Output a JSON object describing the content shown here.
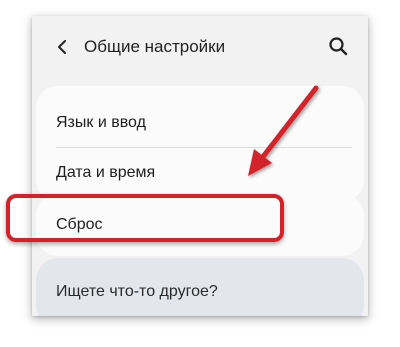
{
  "header": {
    "title": "Общие настройки",
    "back_icon": "chevron-left-icon",
    "search_icon": "search-icon"
  },
  "settings": {
    "items": [
      {
        "label": "Язык и ввод"
      },
      {
        "label": "Дата и время"
      }
    ],
    "reset": {
      "label": "Сброс"
    }
  },
  "other": {
    "label": "Ищете что-то другое?"
  },
  "annotation": {
    "highlight_color": "#d2232a",
    "arrow_color": "#d2232a"
  },
  "colors": {
    "background": "#f2f2f2",
    "card": "#fbfbfb",
    "suggestion_card": "#e3e7ec"
  }
}
